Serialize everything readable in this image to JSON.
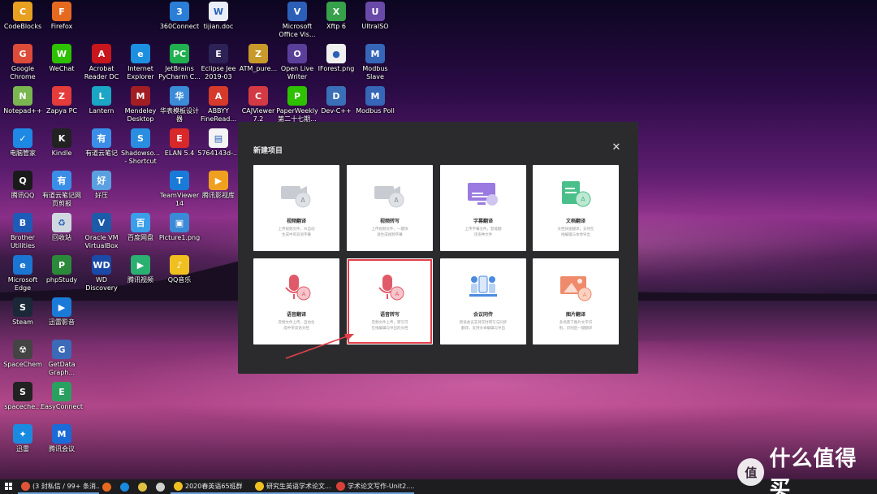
{
  "desktop_icons": [
    {
      "label": "CodeBlocks",
      "color": "#e8a020",
      "glyph": "C"
    },
    {
      "label": "Firefox",
      "color": "#e56a1f",
      "glyph": "F"
    },
    {
      "label": "360Connect",
      "color": "#2a7ed6",
      "glyph": "3"
    },
    {
      "label": "tijian.doc",
      "color": "#e9eef8",
      "glyph": "W"
    },
    {
      "label": "Microsoft\nOffice Vis...",
      "color": "#2b5fb8",
      "glyph": "V"
    },
    {
      "label": "Xftp 6",
      "color": "#36a04a",
      "glyph": "X"
    },
    {
      "label": "UltraISO",
      "color": "#6a4aa8",
      "glyph": "U"
    },
    {
      "label": "Google\nChrome",
      "color": "#dd4b39",
      "glyph": "G"
    },
    {
      "label": "WeChat",
      "color": "#2dc100",
      "glyph": "W"
    },
    {
      "label": "Acrobat\nReader DC",
      "color": "#c8161d",
      "glyph": "A"
    },
    {
      "label": "Internet\nExplorer",
      "color": "#1c8fe0",
      "glyph": "e"
    },
    {
      "label": "JetBrains\nPyCharm C...",
      "color": "#20b050",
      "glyph": "PC"
    },
    {
      "label": "Eclipse Jee\n2019-03",
      "color": "#2c2255",
      "glyph": "E"
    },
    {
      "label": "ATM_pure...",
      "color": "#c89a2a",
      "glyph": "Z"
    },
    {
      "label": "Open Live\nWriter",
      "color": "#5a3f9a",
      "glyph": "O"
    },
    {
      "label": "IForest.png",
      "color": "#f0f0f0",
      "glyph": "●"
    },
    {
      "label": "Modbus\nSlave",
      "color": "#3566b8",
      "glyph": "M"
    },
    {
      "label": "Notepad++",
      "color": "#7ab650",
      "glyph": "N"
    },
    {
      "label": "Zapya PC",
      "color": "#e43b3b",
      "glyph": "Z"
    },
    {
      "label": "Lantern",
      "color": "#1aa6c4",
      "glyph": "L"
    },
    {
      "label": "Mendeley\nDesktop",
      "color": "#a31e22",
      "glyph": "M"
    },
    {
      "label": "华表模板设计\n器",
      "color": "#3a8bd8",
      "glyph": "华"
    },
    {
      "label": "ABBYY\nFineRead...",
      "color": "#d63a2a",
      "glyph": "A"
    },
    {
      "label": "CAJViewer\n7.2",
      "color": "#d43a44",
      "glyph": "C"
    },
    {
      "label": "PaperWeekly\n第二十七期...",
      "color": "#2dc100",
      "glyph": "P"
    },
    {
      "label": "Dev-C++",
      "color": "#3a6fb8",
      "glyph": "D"
    },
    {
      "label": "Modbus Poll",
      "color": "#3566b8",
      "glyph": "M"
    },
    {
      "label": "电脑管家",
      "color": "#1e88e5",
      "glyph": "✓"
    },
    {
      "label": "Kindle",
      "color": "#222222",
      "glyph": "K"
    },
    {
      "label": "有道云笔记",
      "color": "#3a8ee8",
      "glyph": "有"
    },
    {
      "label": "Shadowso...\n- Shortcut",
      "color": "#2a8de0",
      "glyph": "S"
    },
    {
      "label": "ELAN 5.4",
      "color": "#d8282a",
      "glyph": "E"
    },
    {
      "label": "5764143d-...",
      "color": "#f4f4f4",
      "glyph": "▤"
    },
    {
      "label": "腾讯QQ",
      "color": "#1a1a1a",
      "glyph": "Q"
    },
    {
      "label": "有道云笔记网\n页剪报",
      "color": "#3a8ee8",
      "glyph": "有"
    },
    {
      "label": "好压",
      "color": "#5aa0e0",
      "glyph": "好"
    },
    {
      "label": "TeamViewer\n14",
      "color": "#1a7ad8",
      "glyph": "T"
    },
    {
      "label": "腾讯影视库",
      "color": "#f0a020",
      "glyph": "▶"
    },
    {
      "label": "Brother\nUtilities",
      "color": "#1e5bb8",
      "glyph": "B"
    },
    {
      "label": "回收站",
      "color": "#cfd8e0",
      "glyph": "♻"
    },
    {
      "label": "Oracle VM\nVirtualBox",
      "color": "#1c5ba8",
      "glyph": "V"
    },
    {
      "label": "百度网盘",
      "color": "#3a9ee8",
      "glyph": "百"
    },
    {
      "label": "Picture1.png",
      "color": "#3a8ad8",
      "glyph": "▣"
    },
    {
      "label": "Microsoft\nEdge",
      "color": "#1a76d2",
      "glyph": "e"
    },
    {
      "label": "phpStudy",
      "color": "#2a8a3a",
      "glyph": "P"
    },
    {
      "label": "WD\nDiscovery",
      "color": "#1a4aa8",
      "glyph": "WD"
    },
    {
      "label": "腾讯视频",
      "color": "#2ab070",
      "glyph": "▶"
    },
    {
      "label": "QQ音乐",
      "color": "#f0c020",
      "glyph": "♪"
    },
    {
      "label": "Steam",
      "color": "#1b2838",
      "glyph": "S"
    },
    {
      "label": "迅雷影音",
      "color": "#1a7ad8",
      "glyph": "▶"
    },
    {
      "label": "SpaceChem",
      "color": "#444444",
      "glyph": "☢"
    },
    {
      "label": "GetData\nGraph...",
      "color": "#3a6ab8",
      "glyph": "G"
    },
    {
      "label": "spaceche...",
      "color": "#222222",
      "glyph": "S"
    },
    {
      "label": "EasyConnect",
      "color": "#2aa060",
      "glyph": "E"
    },
    {
      "label": "迅雷",
      "color": "#1a8ae0",
      "glyph": "✦"
    },
    {
      "label": "腾讯会议",
      "color": "#1a6ad8",
      "glyph": "M"
    }
  ],
  "dialog": {
    "title": "新建项目",
    "close_glyph": "✕",
    "cards": [
      {
        "title": "视频翻译",
        "desc": "上传视频文件，AI自动\n生成中英双语字幕",
        "art": "video"
      },
      {
        "title": "视频转写",
        "desc": "上传视频文件，一键快\n速生成视频字幕",
        "art": "video"
      },
      {
        "title": "字幕翻译",
        "desc": "上传字幕文件，智能翻\n译多种文件",
        "art": "subtitle"
      },
      {
        "title": "文档翻译",
        "desc": "文档快速翻译，支持在\n线编辑与本地导出",
        "art": "doc"
      },
      {
        "title": "语音翻译",
        "desc": "音频文件上传，自动生\n成中英双语文档",
        "art": "mic"
      },
      {
        "title": "语音转写",
        "desc": "音频文件上传，转写可\n在线编辑与导出的文档",
        "art": "mic"
      },
      {
        "title": "会议同传",
        "desc": "跨语会议支持实时转写与同步\n翻译，支持文本编辑与导出",
        "art": "meeting"
      },
      {
        "title": "图片翻译",
        "desc": "多场景下图片文字识\n别，识别后一键翻译",
        "art": "image"
      }
    ]
  },
  "taskbar": {
    "items": [
      {
        "label": "(3 封私信 / 99+ 条消...",
        "color": "#e0543a"
      },
      {
        "label": "",
        "color": "#e56a1f"
      },
      {
        "label": "",
        "color": "#1a8ae0"
      },
      {
        "label": "",
        "color": "#e0c040"
      },
      {
        "label": "",
        "color": "#d0d0d0"
      },
      {
        "label": "2020春英语65班群",
        "color": "#f0c020"
      },
      {
        "label": "研究生英语学术论文...",
        "color": "#f0c020"
      },
      {
        "label": "学术论文写作-Unit2....",
        "color": "#d8403a"
      }
    ]
  },
  "watermark": {
    "badge": "值",
    "text": "什么值得买"
  },
  "colors": {
    "accent_red": "#e0404a",
    "dialog_bg": "#2b2b2e",
    "card_bg": "#ffffff",
    "art_red": "#e05a6a",
    "art_gray": "#c8ccd2",
    "art_purple": "#9a7ae0",
    "art_green": "#4abf8a",
    "art_blue": "#4a8ae0",
    "art_orange": "#ef8a6a"
  }
}
